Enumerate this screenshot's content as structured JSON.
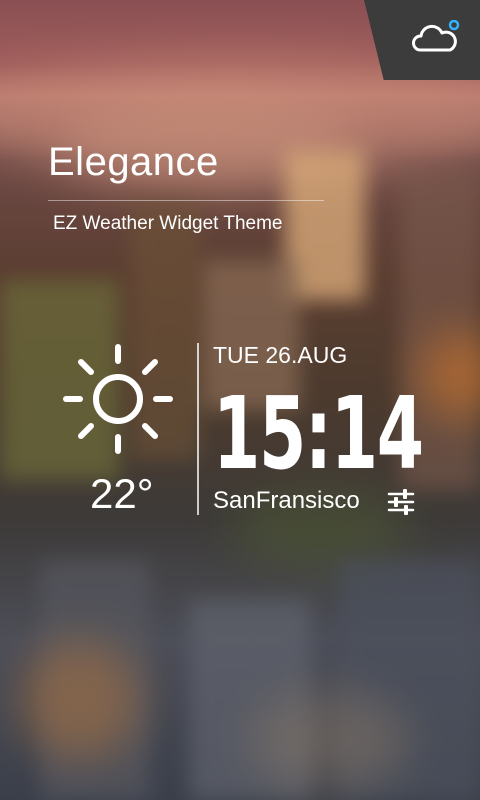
{
  "theme": {
    "title": "Elegance",
    "subtitle": "EZ Weather Widget Theme"
  },
  "weather": {
    "temperature": "22°",
    "condition_icon": "sun-icon"
  },
  "clock": {
    "date": "TUE 26.AUG",
    "time": "15:14"
  },
  "location": {
    "city": "SanFransisco"
  },
  "icons": {
    "corner": "cloud-icon",
    "settings": "settings-sliders-icon"
  },
  "colors": {
    "accent": "#2fb5ff",
    "corner_bg": "#3c3c3c",
    "text": "#ffffff"
  }
}
